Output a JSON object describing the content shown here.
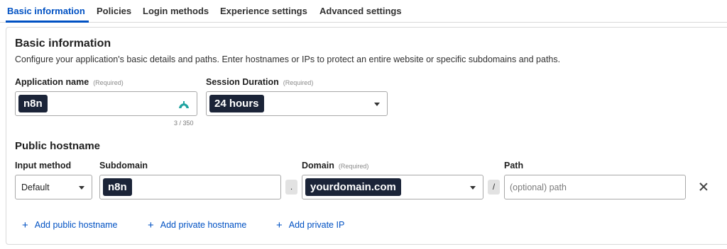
{
  "tabs": [
    {
      "label": "Basic information",
      "active": true
    },
    {
      "label": "Policies"
    },
    {
      "label": "Login methods"
    },
    {
      "label": "Experience settings"
    },
    {
      "label": "Advanced settings"
    }
  ],
  "basic": {
    "title": "Basic information",
    "description": "Configure your application's basic details and paths. Enter hostnames or IPs to protect an entire website or specific subdomains and paths.",
    "app_name": {
      "label": "Application name",
      "required": "(Required)",
      "value": "n8n",
      "counter": "3 / 350",
      "icon": "app-logo-icon"
    },
    "session": {
      "label": "Session Duration",
      "required": "(Required)",
      "value": "24 hours"
    }
  },
  "public_hostname": {
    "title": "Public hostname",
    "input_method": {
      "label": "Input method",
      "value": "Default"
    },
    "subdomain": {
      "label": "Subdomain",
      "value": "n8n"
    },
    "dot": ".",
    "domain": {
      "label": "Domain",
      "required": "(Required)",
      "value": "yourdomain.com"
    },
    "slash": "/",
    "path": {
      "label": "Path",
      "placeholder": "(optional) path"
    }
  },
  "actions": {
    "add_public_hostname": "Add public hostname",
    "add_private_hostname": "Add private hostname",
    "add_private_ip": "Add private IP",
    "plus": "+"
  },
  "colors": {
    "accent": "#0051c3",
    "pill": "#1b2438",
    "logo": "#1fa3a0"
  }
}
